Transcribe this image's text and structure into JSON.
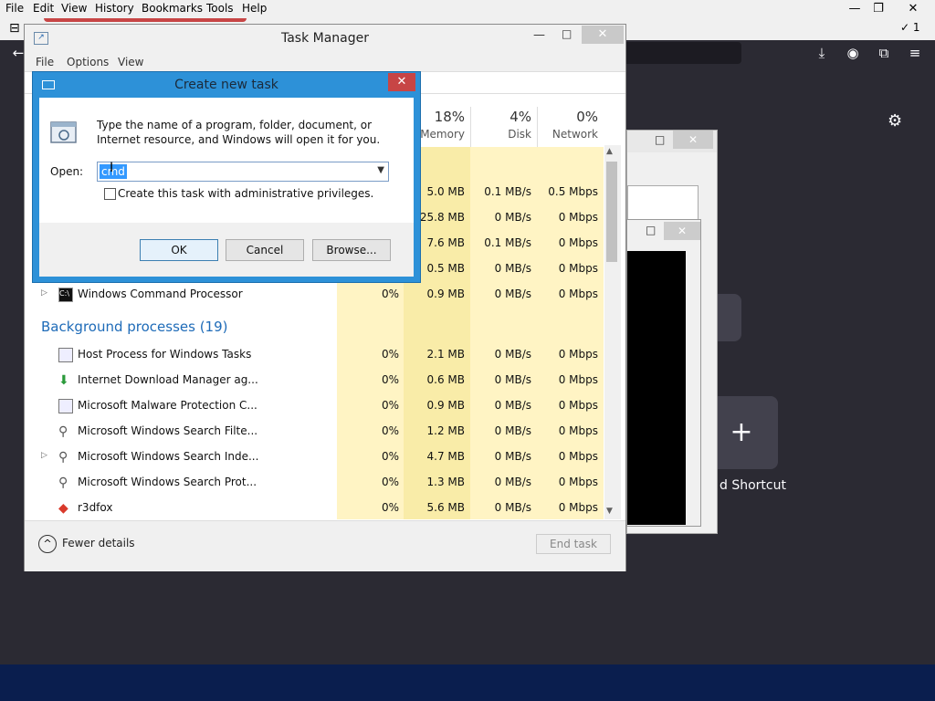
{
  "firefox": {
    "menu": [
      "File",
      "Edit",
      "View",
      "History",
      "Bookmarks",
      "Tools",
      "Help"
    ],
    "tab_count": "1",
    "shortcut_label": "d Shortcut"
  },
  "taskmanager": {
    "title": "Task Manager",
    "menu": [
      "File",
      "Options",
      "View"
    ],
    "columns": [
      {
        "pct": "18%",
        "label": "Memory"
      },
      {
        "pct": "4%",
        "label": "Disk"
      },
      {
        "pct": "0%",
        "label": "Network"
      }
    ],
    "partial_rows": [
      {
        "cpu": "",
        "memory": "5.0 MB",
        "disk": "0.1 MB/s",
        "network": "0.5 Mbps"
      },
      {
        "cpu": "",
        "memory": "125.8 MB",
        "disk": "0 MB/s",
        "network": "0 Mbps"
      },
      {
        "cpu": "",
        "memory": "7.6 MB",
        "disk": "0.1 MB/s",
        "network": "0 Mbps"
      },
      {
        "cpu": "",
        "memory": "0.5 MB",
        "disk": "0 MB/s",
        "network": "0 Mbps"
      }
    ],
    "app_row": {
      "name": "Windows Command Processor",
      "cpu": "0%",
      "memory": "0.9 MB",
      "disk": "0 MB/s",
      "network": "0 Mbps"
    },
    "background_header": "Background processes (19)",
    "background_rows": [
      {
        "name": "Host Process for Windows Tasks",
        "cpu": "0%",
        "memory": "2.1 MB",
        "disk": "0 MB/s",
        "network": "0 Mbps"
      },
      {
        "name": "Internet Download Manager ag...",
        "cpu": "0%",
        "memory": "0.6 MB",
        "disk": "0 MB/s",
        "network": "0 Mbps"
      },
      {
        "name": "Microsoft Malware Protection C...",
        "cpu": "0%",
        "memory": "0.9 MB",
        "disk": "0 MB/s",
        "network": "0 Mbps"
      },
      {
        "name": "Microsoft Windows Search Filte...",
        "cpu": "0%",
        "memory": "1.2 MB",
        "disk": "0 MB/s",
        "network": "0 Mbps"
      },
      {
        "name": "Microsoft Windows Search Inde...",
        "cpu": "0%",
        "memory": "4.7 MB",
        "disk": "0 MB/s",
        "network": "0 Mbps"
      },
      {
        "name": "Microsoft Windows Search Prot...",
        "cpu": "0%",
        "memory": "1.3 MB",
        "disk": "0 MB/s",
        "network": "0 Mbps"
      },
      {
        "name": "r3dfox",
        "cpu": "0%",
        "memory": "5.6 MB",
        "disk": "0 MB/s",
        "network": "0 Mbps"
      }
    ],
    "fewer_details": "Fewer details",
    "end_task": "End task"
  },
  "dialog": {
    "title": "Create new task",
    "description": "Type the name of a program, folder, document, or Internet resource, and Windows will open it for you.",
    "open_label": "Open:",
    "open_value": "cmd",
    "admin_label": "Create this task with administrative privileges.",
    "ok": "OK",
    "cancel": "Cancel",
    "browse": "Browse..."
  },
  "colors": {
    "dialog_frame": "#2d91d8",
    "column_heat_light": "#fff4c4",
    "column_heat_mid": "#f9eca8",
    "group_header": "#1e6bb8",
    "close_red": "#c74545"
  }
}
